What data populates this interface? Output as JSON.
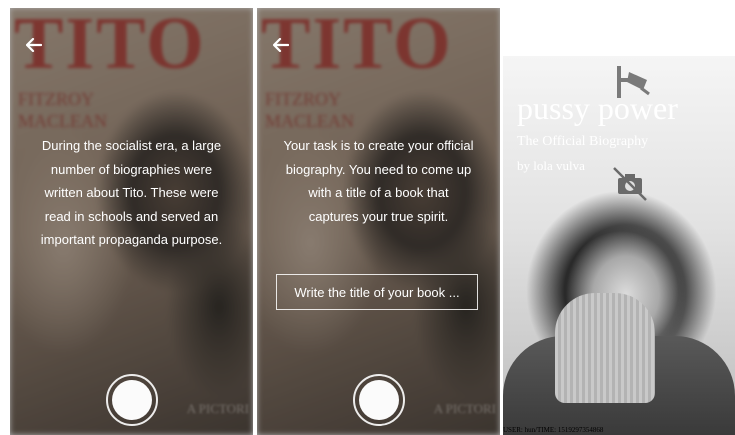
{
  "screens": [
    {
      "cover": {
        "title": "TITO",
        "subtitle_lines": [
          "FITZROY",
          "MACLEAN"
        ],
        "corner_text": "A PICTORI"
      },
      "back_icon": "arrow-left-icon",
      "message": "During the socialist era, a large number of biographies were written about Tito. These were read in schools and served an important propaganda purpose.",
      "shutter_icon": "capture-icon"
    },
    {
      "cover": {
        "title": "TITO",
        "subtitle_lines": [
          "FITZROY",
          "MACLEAN"
        ],
        "corner_text": "A PICTORI"
      },
      "back_icon": "arrow-left-icon",
      "message": "Your task is to create your official biography. You need to come up with a title of a book that captures your true spirit.",
      "title_input": {
        "placeholder": "Write the title of your book ...",
        "value": ""
      },
      "shutter_icon": "capture-icon"
    },
    {
      "book_title": "pussy power",
      "book_subtitle": "The Official Biography",
      "author_line": "by lola vulva",
      "icons": [
        "surveillance-camera-icon",
        "no-camera-icon"
      ],
      "footer": "USER: hun/TIME: 1519297354868"
    }
  ],
  "colors": {
    "cover_title_red": "#b7403a",
    "overlay_text": "#ffffff"
  }
}
